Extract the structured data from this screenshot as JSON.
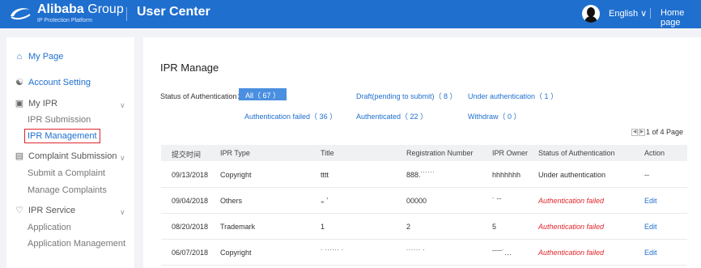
{
  "header": {
    "logo_name": "Alibaba",
    "logo_group": "Group",
    "logo_sub": "IP Protection Platform",
    "title": "User Center",
    "language": "English ∨",
    "home": "Home page"
  },
  "sidebar": {
    "my_page": "My Page",
    "account_setting": "Account Setting",
    "my_ipr": "My IPR",
    "ipr_submission": "IPR Submission",
    "ipr_management": "IPR Management",
    "complaint_submission": "Complaint Submission",
    "submit_complaint": "Submit a Complaint",
    "manage_complaints": "Manage Complaints",
    "ipr_service": "IPR Service",
    "application": "Application",
    "application_management": "Application Management"
  },
  "main": {
    "title": "IPR Manage",
    "filter_label": "Status of Authentication：",
    "filters": {
      "all": "All（ 67 ）",
      "draft": "Draft(pending to submit)（ 8 ）",
      "under": "Under authentication（ 1 ）",
      "failed": "Authentication failed（ 36 ）",
      "authenticated": "Authenticated（ 22 ）",
      "withdraw": "Withdraw（ 0 ）"
    },
    "pager": "1 of 4 Page",
    "columns": [
      "提交时间",
      "IPR Type",
      "Title",
      "Registration Number",
      "IPR Owner",
      "Status of Authentication",
      "Action"
    ],
    "rows": [
      {
        "date": "09/13/2018",
        "type": "Copyright",
        "title": "tttt",
        "reg": "888.˙˙˙˙˙˙",
        "owner": "hhhhhhh",
        "status": "Under authentication",
        "action": "--"
      },
      {
        "date": "09/04/2018",
        "type": "Others",
        "title": "₌          ʼ",
        "reg": "00000",
        "owner": "˙ ˉˉ",
        "status": "Authentication failed",
        "action": "Edit"
      },
      {
        "date": "08/20/2018",
        "type": "Trademark",
        "title": "1",
        "reg": "2",
        "owner": "5",
        "status": "Authentication failed",
        "action": "Edit"
      },
      {
        "date": "06/07/2018",
        "type": "Copyright",
        "title": "˙ ˙˙˙˙˙˙ ˙",
        "reg": "˙˙˙˙˙˙ ˙",
        "owner": "ˉˉˉˉ˙…",
        "status": "Authentication failed",
        "action": "Edit"
      }
    ]
  }
}
